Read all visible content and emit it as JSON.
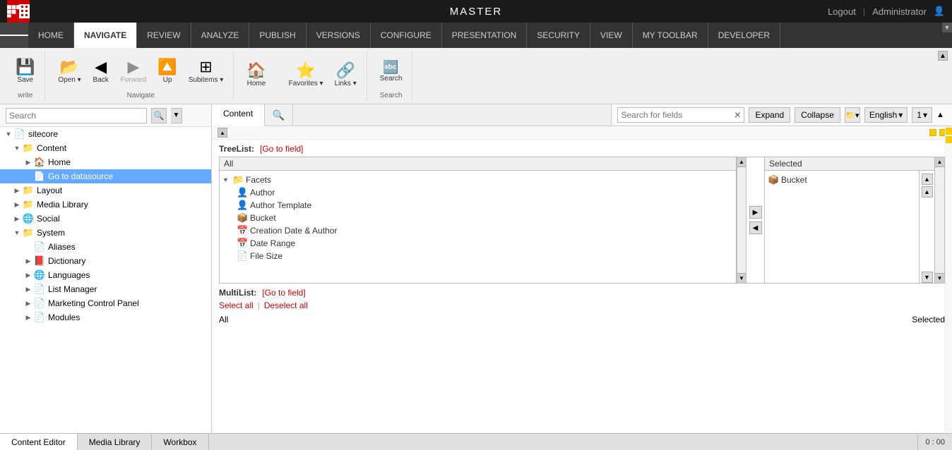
{
  "topbar": {
    "title": "MASTER",
    "logout": "Logout",
    "separator": "|",
    "user": "Administrator"
  },
  "nav": {
    "items": [
      {
        "id": "home",
        "label": "HOME",
        "active": false
      },
      {
        "id": "navigate",
        "label": "NAVIGATE",
        "active": true
      },
      {
        "id": "review",
        "label": "REVIEW",
        "active": false
      },
      {
        "id": "analyze",
        "label": "ANALYZE",
        "active": false
      },
      {
        "id": "publish",
        "label": "PUBLISH",
        "active": false
      },
      {
        "id": "versions",
        "label": "VERSIONS",
        "active": false
      },
      {
        "id": "configure",
        "label": "CONFIGURE",
        "active": false
      },
      {
        "id": "presentation",
        "label": "PRESENTATION",
        "active": false
      },
      {
        "id": "security",
        "label": "SECURITY",
        "active": false
      },
      {
        "id": "view",
        "label": "VIEW",
        "active": false
      },
      {
        "id": "my-toolbar",
        "label": "MY TOOLBAR",
        "active": false
      },
      {
        "id": "developer",
        "label": "DEVELOPER",
        "active": false
      }
    ]
  },
  "ribbon": {
    "groups": [
      {
        "id": "write",
        "label": "Write",
        "buttons": [
          {
            "id": "save",
            "label": "Save",
            "icon": "💾"
          }
        ]
      },
      {
        "id": "navigate-group",
        "label": "Navigate",
        "buttons": [
          {
            "id": "open",
            "label": "Open",
            "icon": "📂",
            "dropdown": true
          },
          {
            "id": "back",
            "label": "Back",
            "icon": "◀"
          },
          {
            "id": "forward",
            "label": "Forward",
            "icon": "▶",
            "disabled": true
          },
          {
            "id": "up",
            "label": "Up",
            "icon": "▲"
          },
          {
            "id": "subitems",
            "label": "Subitems",
            "icon": "⊞",
            "dropdown": true
          }
        ]
      },
      {
        "id": "navigate-home",
        "label": "",
        "buttons": [
          {
            "id": "home-btn",
            "label": "Home",
            "icon": "🏠"
          }
        ]
      },
      {
        "id": "favorites-group",
        "label": "",
        "buttons": [
          {
            "id": "favorites",
            "label": "Favorites",
            "icon": "⭐",
            "dropdown": true
          },
          {
            "id": "links",
            "label": "Links",
            "icon": "🔗",
            "dropdown": true
          }
        ]
      },
      {
        "id": "search-group",
        "label": "Search",
        "buttons": [
          {
            "id": "search-btn",
            "label": "Search",
            "icon": "🔤"
          }
        ]
      }
    ]
  },
  "searchbar": {
    "placeholder": "Search",
    "value": ""
  },
  "content": {
    "tabs": [
      {
        "id": "content",
        "label": "Content",
        "active": true
      },
      {
        "id": "search-tab",
        "label": "",
        "icon": "🔍"
      }
    ]
  },
  "field_toolbar": {
    "search_placeholder": "Search for fields",
    "expand_label": "Expand",
    "collapse_label": "Collapse",
    "language": "English",
    "version": "1"
  },
  "tree": {
    "items": [
      {
        "id": "sitecore",
        "label": "sitecore",
        "icon": "📄",
        "level": 0,
        "expanded": true,
        "arrow": "open"
      },
      {
        "id": "content",
        "label": "Content",
        "icon": "📁",
        "level": 1,
        "expanded": true,
        "arrow": "open",
        "color": "#3366cc"
      },
      {
        "id": "home",
        "label": "Home",
        "icon": "🏠",
        "level": 2,
        "expanded": false,
        "arrow": "closed"
      },
      {
        "id": "go-to-datasource",
        "label": "Go to datasource",
        "icon": "📄",
        "level": 2,
        "expanded": false,
        "arrow": "leaf",
        "selected": true
      },
      {
        "id": "layout",
        "label": "Layout",
        "icon": "📁",
        "level": 1,
        "expanded": false,
        "arrow": "closed"
      },
      {
        "id": "media-library",
        "label": "Media Library",
        "icon": "📁",
        "level": 1,
        "expanded": false,
        "arrow": "closed"
      },
      {
        "id": "social",
        "label": "Social",
        "icon": "📁",
        "level": 1,
        "expanded": false,
        "arrow": "closed"
      },
      {
        "id": "system",
        "label": "System",
        "icon": "📁",
        "level": 1,
        "expanded": true,
        "arrow": "open"
      },
      {
        "id": "aliases",
        "label": "Aliases",
        "icon": "📄",
        "level": 2,
        "expanded": false,
        "arrow": "leaf"
      },
      {
        "id": "dictionary",
        "label": "Dictionary",
        "icon": "📕",
        "level": 2,
        "expanded": false,
        "arrow": "closed"
      },
      {
        "id": "languages",
        "label": "Languages",
        "icon": "🌐",
        "level": 2,
        "expanded": false,
        "arrow": "closed"
      },
      {
        "id": "list-manager",
        "label": "List Manager",
        "icon": "📄",
        "level": 2,
        "expanded": false,
        "arrow": "closed"
      },
      {
        "id": "marketing-control-panel",
        "label": "Marketing Control Panel",
        "icon": "📄",
        "level": 2,
        "expanded": false,
        "arrow": "closed"
      },
      {
        "id": "modules",
        "label": "Modules",
        "icon": "📄",
        "level": 2,
        "expanded": false,
        "arrow": "closed"
      }
    ]
  },
  "treelist": {
    "label": "TreeList:",
    "link_text": "[Go to field]",
    "all_label": "All",
    "selected_label": "Selected",
    "left_nodes": [
      {
        "id": "facets",
        "label": "Facets",
        "icon": "📁",
        "level": 0,
        "expanded": true,
        "arrow": "open"
      },
      {
        "id": "author",
        "label": "Author",
        "icon": "👤",
        "level": 1
      },
      {
        "id": "author-template",
        "label": "Author Template",
        "icon": "👤",
        "level": 1
      },
      {
        "id": "bucket",
        "label": "Bucket",
        "icon": "📦",
        "level": 1
      },
      {
        "id": "creation-date-author",
        "label": "Creation Date & Author",
        "icon": "📅",
        "level": 1
      },
      {
        "id": "date-range",
        "label": "Date Range",
        "icon": "📅",
        "level": 1
      },
      {
        "id": "file-size",
        "label": "File Size",
        "icon": "📄",
        "level": 1
      }
    ],
    "right_nodes": [
      {
        "id": "bucket-selected",
        "label": "Bucket",
        "icon": "📦"
      }
    ]
  },
  "multilist": {
    "label": "MultiList:",
    "link_text": "[Go to field]",
    "select_all": "Select all",
    "deselect_all": "Deselect all",
    "separator": "|",
    "all_label": "All",
    "selected_label": "Selected"
  },
  "bottom_tabs": [
    {
      "id": "content-editor",
      "label": "Content Editor",
      "active": true
    },
    {
      "id": "media-library",
      "label": "Media Library",
      "active": false
    },
    {
      "id": "workbox",
      "label": "Workbox",
      "active": false
    }
  ],
  "time": "0 : 00"
}
